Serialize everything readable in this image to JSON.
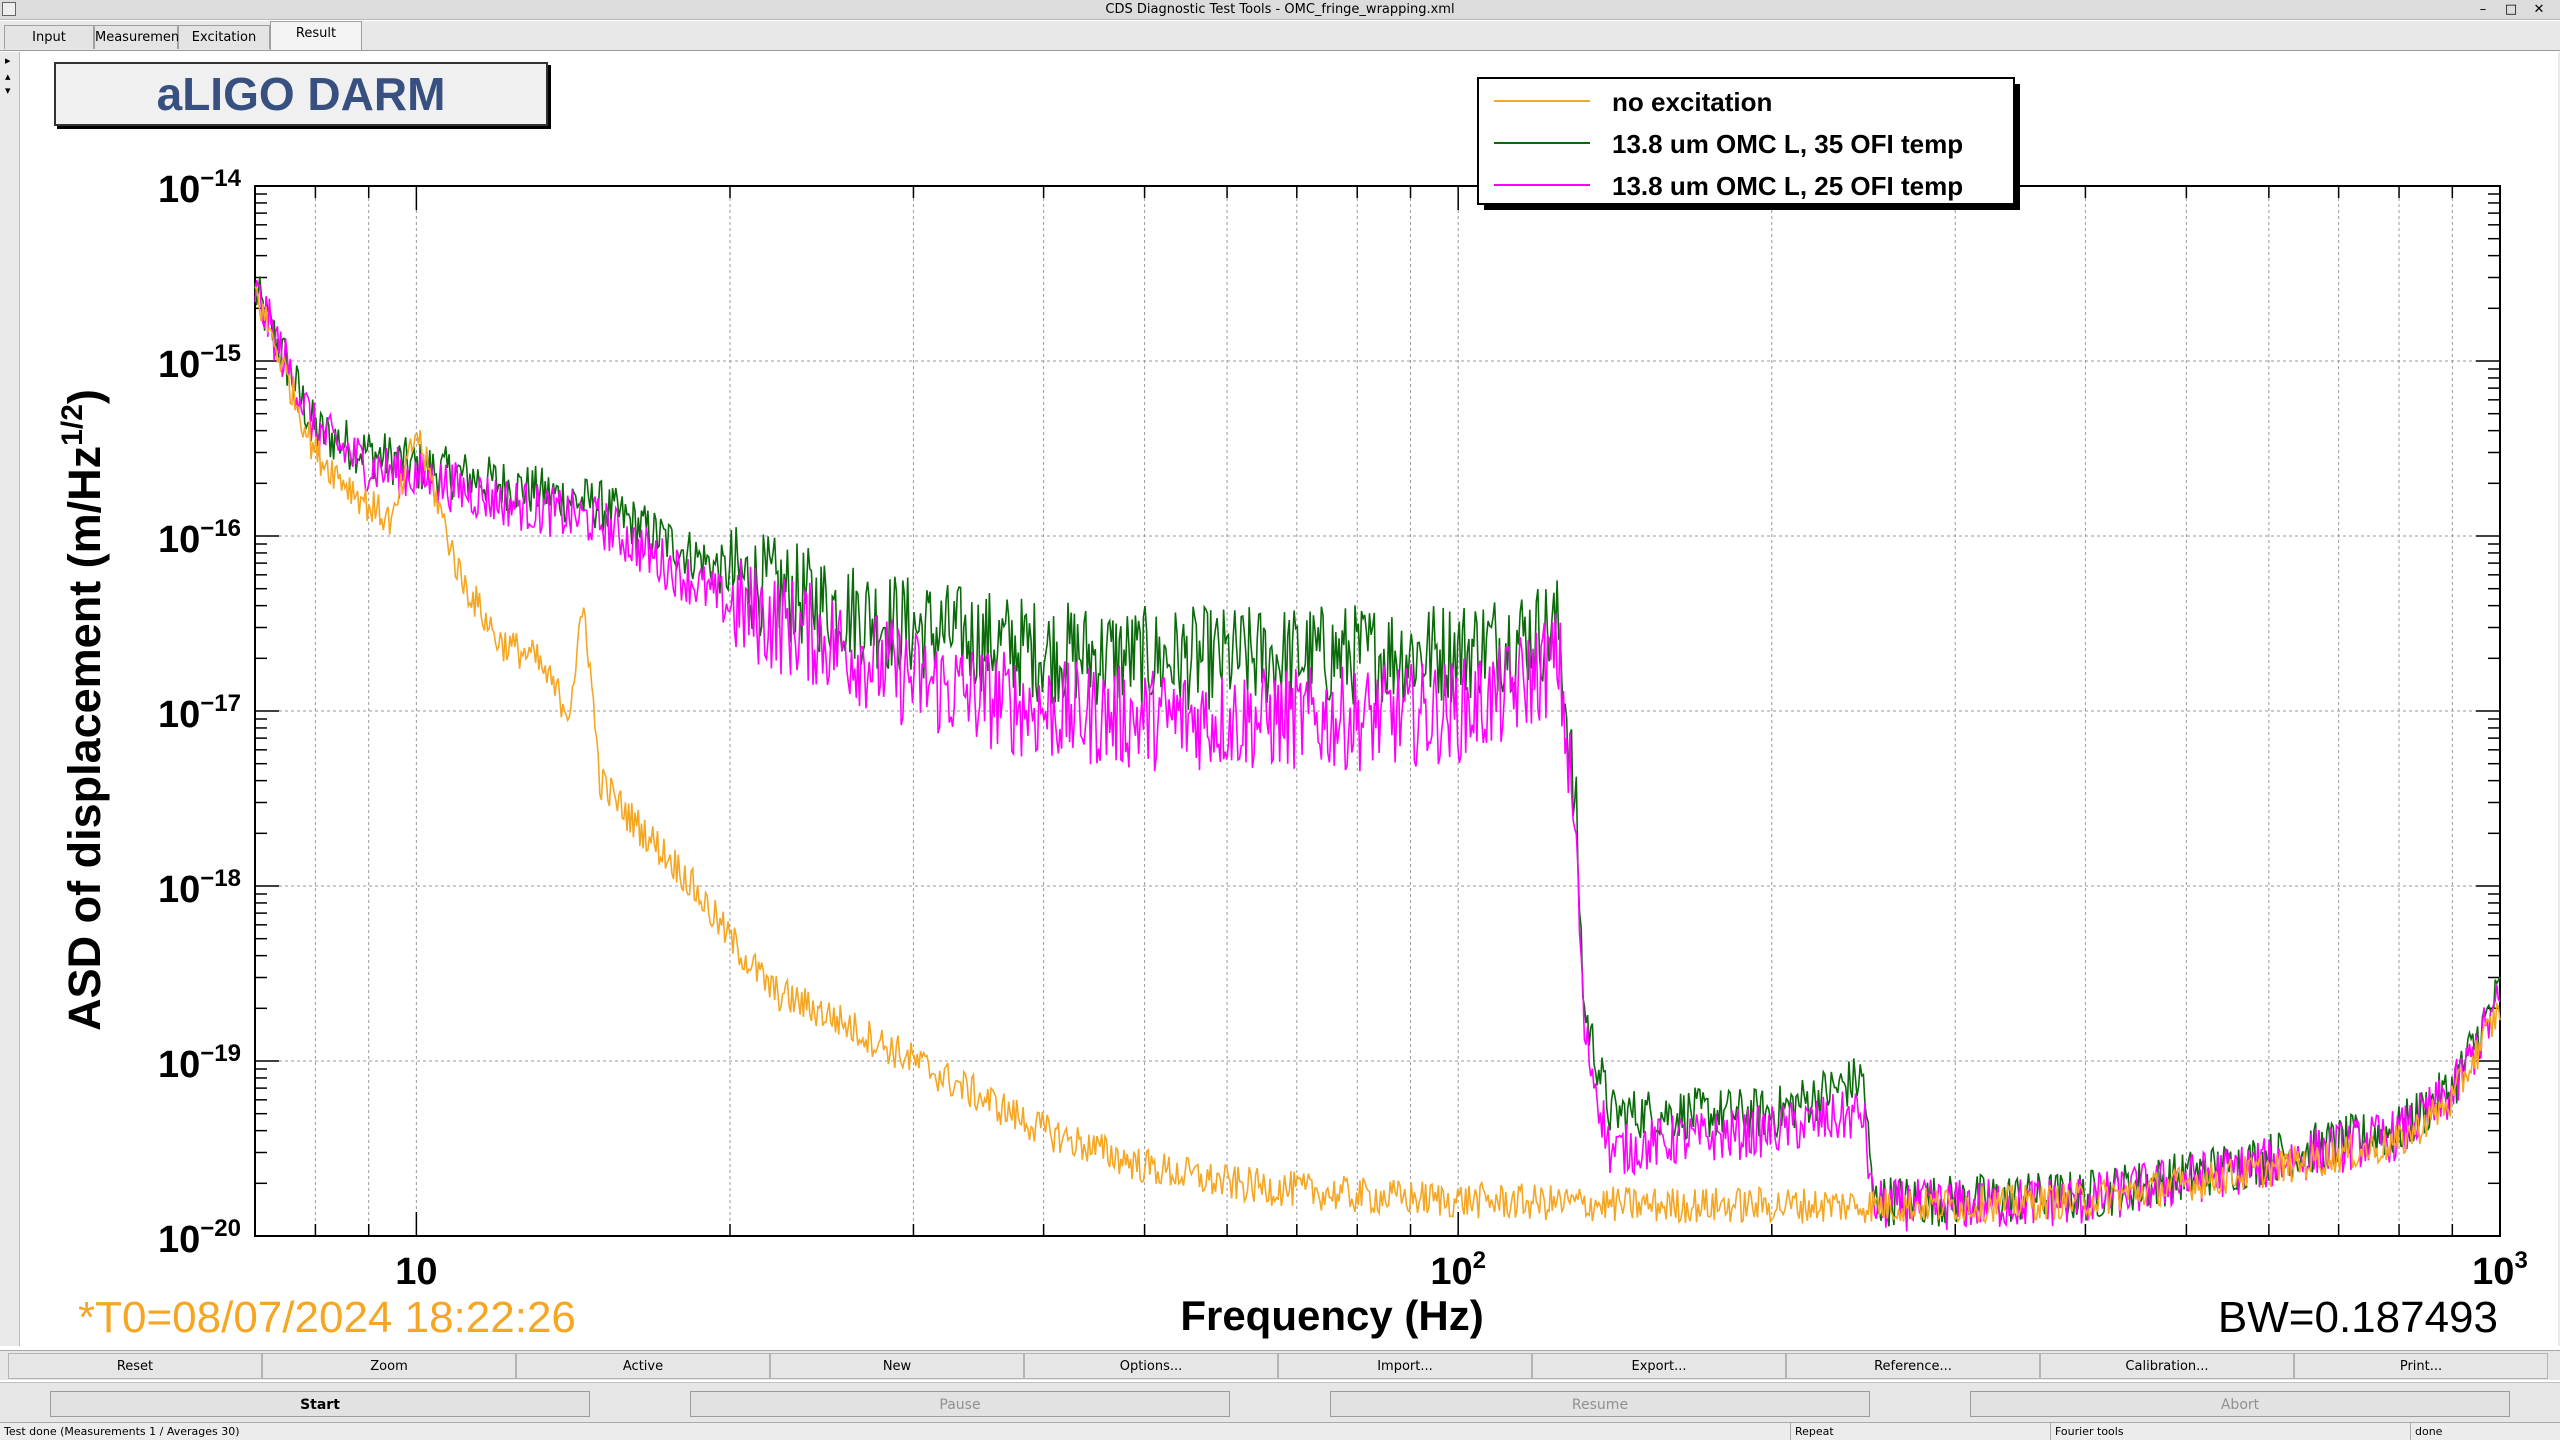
{
  "window": {
    "title": "CDS Diagnostic Test Tools - OMC_fringe_wrapping.xml",
    "controls": [
      "–",
      "□",
      "✕"
    ]
  },
  "tabs": [
    "Input",
    "Measurement",
    "Excitation",
    "Result"
  ],
  "active_tab": "Result",
  "plot_title": "aLIGO DARM",
  "t0_text": "*T0=08/07/2024 18:22:26",
  "bw_text": "BW=0.187493",
  "colors": {
    "no_excitation": "#f5a623",
    "omc_35": "#0b6b0b",
    "omc_25": "#ff00ff",
    "t0": "#f5a623",
    "title_text": "#37507f"
  },
  "chart_data": {
    "type": "line",
    "x_scale": "log",
    "y_scale": "log",
    "xlabel": "Frequency (Hz)",
    "ylabel": "ASD of displacement (m/Hz",
    "ylabel_sup": "1/2",
    "ylabel_end": ")",
    "xlim": [
      7,
      1000
    ],
    "ylim": [
      1e-20,
      1e-14
    ],
    "x_ticks": [
      {
        "value": 10,
        "base": "10",
        "exp": ""
      },
      {
        "value": 100,
        "base": "10",
        "exp": "2"
      },
      {
        "value": 1000,
        "base": "10",
        "exp": "3"
      }
    ],
    "y_ticks": [
      {
        "value": 1e-14,
        "base": "10",
        "exp": "−14"
      },
      {
        "value": 1e-15,
        "base": "10",
        "exp": "−15"
      },
      {
        "value": 1e-16,
        "base": "10",
        "exp": "−16"
      },
      {
        "value": 1e-17,
        "base": "10",
        "exp": "−17"
      },
      {
        "value": 1e-18,
        "base": "10",
        "exp": "−18"
      },
      {
        "value": 1e-19,
        "base": "10",
        "exp": "−19"
      },
      {
        "value": 1e-20,
        "base": "10",
        "exp": "−20"
      }
    ],
    "grid": true,
    "legend_position": "top-right",
    "series": [
      {
        "name": "no excitation",
        "color": "#f5a623",
        "x": [
          7,
          8,
          9,
          9.5,
          10,
          11,
          12,
          13,
          14,
          14.5,
          15,
          16,
          18,
          20,
          22,
          25,
          30,
          40,
          50,
          60,
          80,
          100,
          150,
          200,
          250,
          300,
          400,
          500,
          600,
          700,
          800,
          900,
          1000
        ],
        "y": [
          2.5e-15,
          3e-16,
          1.5e-16,
          1.2e-16,
          4e-16,
          6e-17,
          2.5e-17,
          2e-17,
          1e-17,
          4e-17,
          4e-18,
          2.5e-18,
          1.2e-18,
          5e-19,
          2.5e-19,
          1.8e-19,
          1e-19,
          4e-20,
          2.5e-20,
          2e-20,
          1.7e-20,
          1.6e-20,
          1.5e-20,
          1.5e-20,
          1.5e-20,
          1.5e-20,
          1.6e-20,
          2e-20,
          2.4e-20,
          2.9e-20,
          3.4e-20,
          6e-20,
          2e-19
        ]
      },
      {
        "name": "13.8 um OMC L, 35 OFI temp",
        "color": "#0b6b0b",
        "x": [
          7,
          8,
          9,
          10,
          12,
          15,
          20,
          25,
          30,
          40,
          50,
          60,
          80,
          100,
          110,
          125,
          130,
          132,
          140,
          160,
          200,
          245,
          250,
          300,
          400,
          500,
          600,
          700,
          800,
          900,
          1000
        ],
        "y": [
          2.5e-15,
          4e-16,
          3e-16,
          2.5e-16,
          2e-16,
          1.5e-16,
          6e-17,
          4e-17,
          3e-17,
          2.2e-17,
          2e-17,
          2e-17,
          2.1e-17,
          2.2e-17,
          2.5e-17,
          3e-17,
          2e-18,
          2e-19,
          5e-20,
          5e-20,
          5e-20,
          8e-20,
          1.6e-20,
          1.6e-20,
          1.7e-20,
          2.2e-20,
          2.8e-20,
          3.4e-20,
          4e-20,
          7e-20,
          2.5e-19
        ]
      },
      {
        "name": "13.8 um OMC L, 25 OFI temp",
        "color": "#ff00ff",
        "x": [
          7,
          8,
          9,
          10,
          12,
          15,
          20,
          25,
          30,
          40,
          50,
          60,
          80,
          100,
          110,
          125,
          130,
          132,
          140,
          160,
          200,
          245,
          250,
          300,
          400,
          500,
          600,
          700,
          800,
          900,
          1000
        ],
        "y": [
          2.5e-15,
          4e-16,
          2.5e-16,
          2.2e-16,
          1.6e-16,
          1.2e-16,
          4e-17,
          2.5e-17,
          1.5e-17,
          1e-17,
          9e-18,
          9e-18,
          9e-18,
          1e-17,
          1.2e-17,
          2e-17,
          1.5e-18,
          1.5e-19,
          3e-20,
          3.5e-20,
          4e-20,
          5e-20,
          1.5e-20,
          1.5e-20,
          1.6e-20,
          2.1e-20,
          2.6e-20,
          3.2e-20,
          3.8e-20,
          6.5e-20,
          2.2e-19
        ]
      }
    ]
  },
  "buttons_row1": [
    "Reset",
    "Zoom",
    "Active",
    "New",
    "Options...",
    "Import...",
    "Export...",
    "Reference...",
    "Calibration...",
    "Print..."
  ],
  "buttons_row2": [
    {
      "label": "Start",
      "state": "primary"
    },
    {
      "label": "Pause",
      "state": "disabled"
    },
    {
      "label": "Resume",
      "state": "disabled"
    },
    {
      "label": "Abort",
      "state": "disabled"
    }
  ],
  "status": [
    "Test done (Measurements 1 / Averages 30)",
    "Repeat",
    "Fourier tools",
    "done"
  ]
}
